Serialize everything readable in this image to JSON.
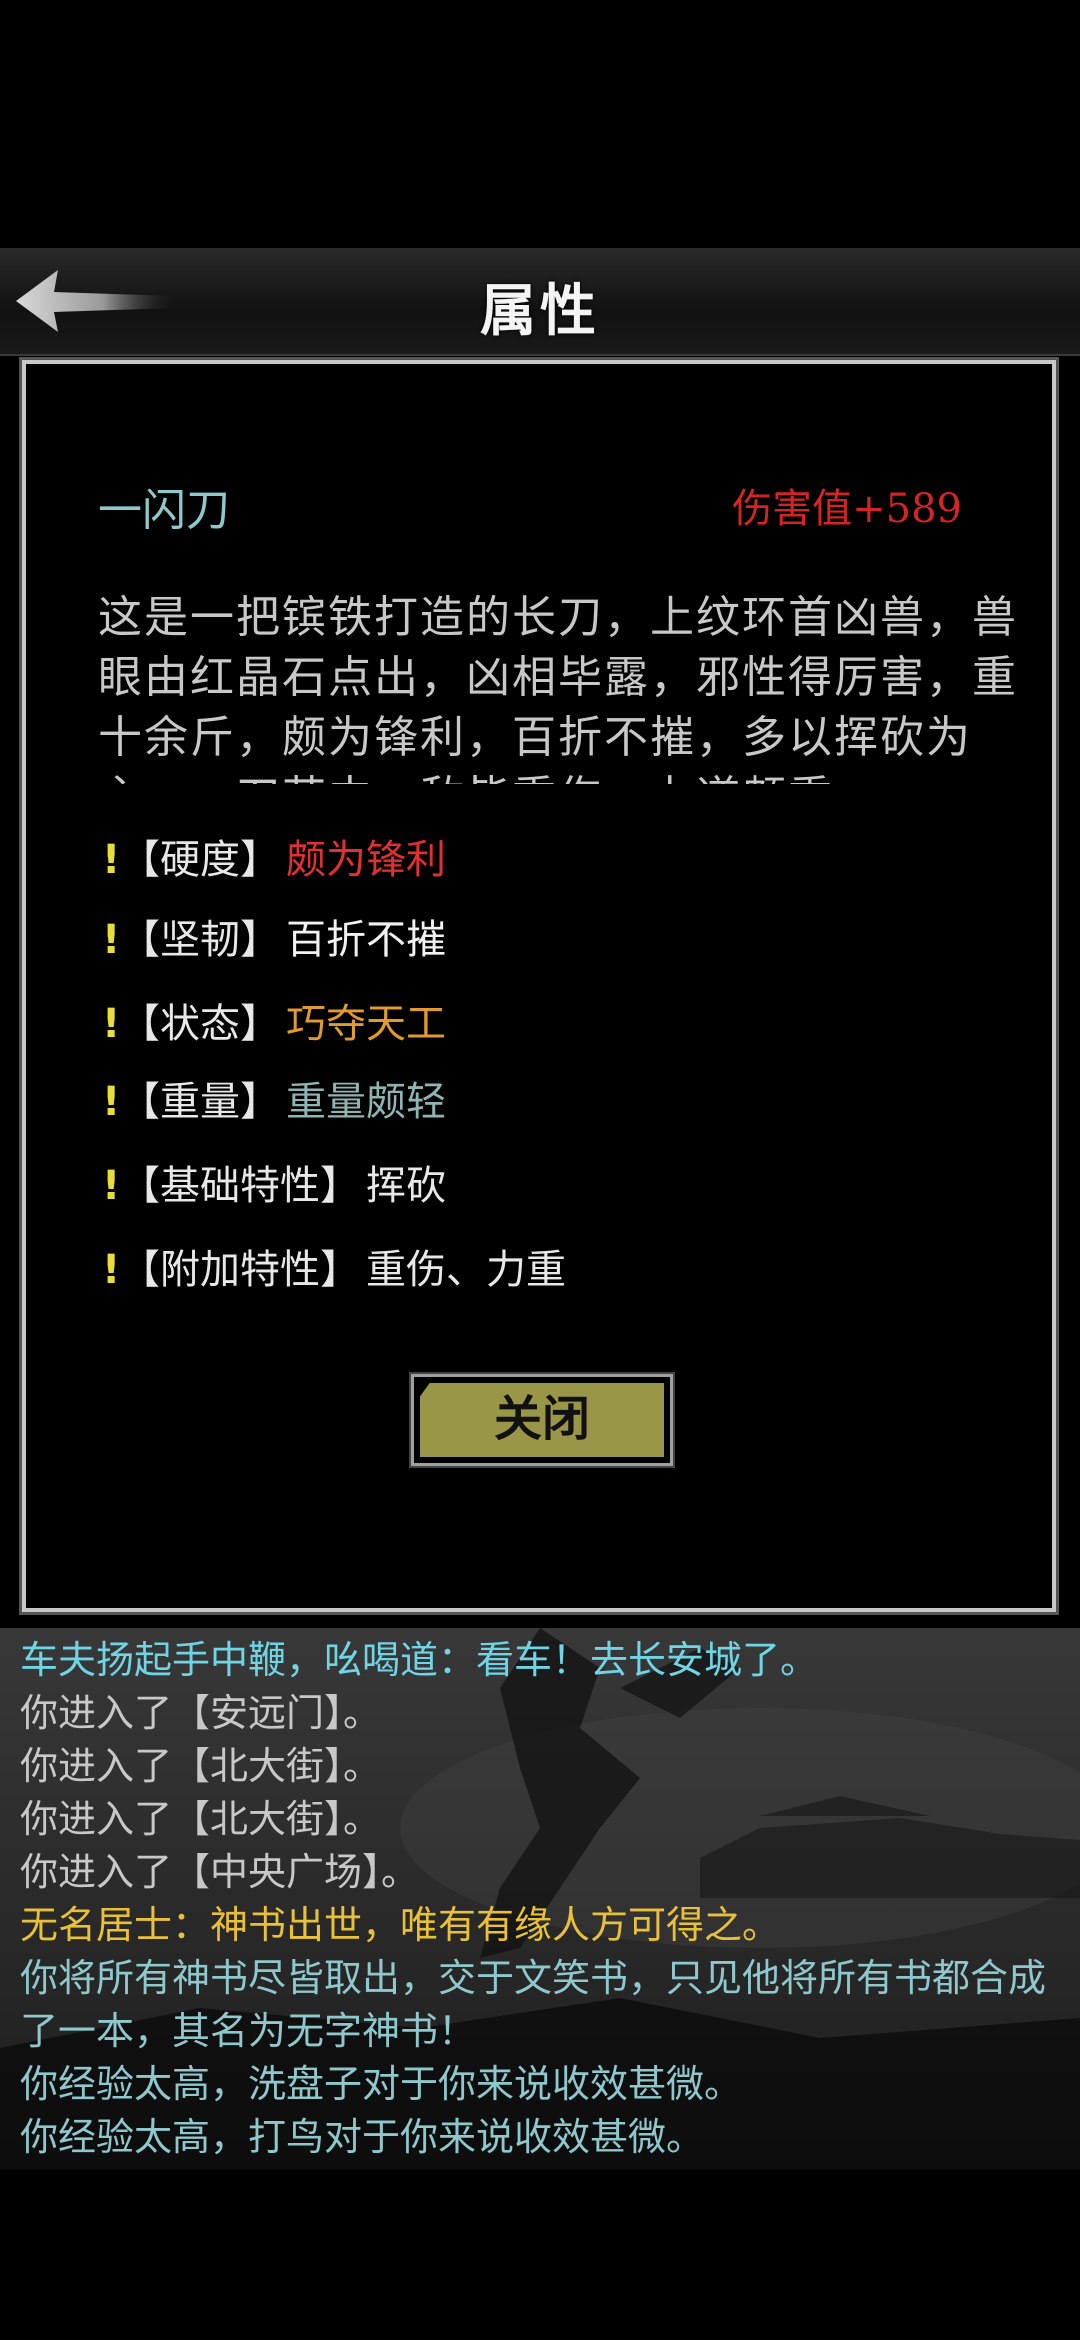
{
  "header": {
    "title": "属性"
  },
  "item": {
    "name": "一闪刀",
    "damage": "伤害值+589",
    "description": "这是一把镔铁打造的长刀，上纹环首凶兽，兽眼由红晶石点出，凶相毕露，邪性得厉害，重十余斤，颇为锋利，百折不摧，多以挥砍为主，一刀若中，敌皆重伤，力道颇重"
  },
  "attributes": [
    {
      "mark": "!",
      "label": "【硬度】",
      "value": "颇为锋利",
      "color": "#e23030"
    },
    {
      "mark": "!",
      "label": "【坚韧】",
      "value": "百折不摧",
      "color": "#f2f2f2"
    },
    {
      "mark": "!",
      "label": "【状态】",
      "value": "巧夺天工",
      "color": "#e09a30"
    },
    {
      "mark": "!",
      "label": "【重量】",
      "value": "重量颇轻",
      "color": "#8fb4b4"
    },
    {
      "mark": "!",
      "label": "【基础特性】",
      "value": "挥砍",
      "color": "#e8e8e8"
    },
    {
      "mark": "!",
      "label": "【附加特性】",
      "value": "重伤、力重",
      "color": "#e8e8e8"
    }
  ],
  "buttons": {
    "close": "关闭"
  },
  "log": [
    {
      "text": "车夫扬起手中鞭，吆喝道：看车！去长安城了。",
      "color": "#6fd4e4"
    },
    {
      "text": "你进入了【安远门】。",
      "color": "#c8c8c8"
    },
    {
      "text": "你进入了【北大街】。",
      "color": "#c8c8c8"
    },
    {
      "text": "你进入了【北大街】。",
      "color": "#c8c8c8"
    },
    {
      "text": "你进入了【中央广场】。",
      "color": "#c8c8c8"
    },
    {
      "text": "无名居士：神书出世，唯有有缘人方可得之。",
      "color": "#e8c03a"
    },
    {
      "text": "你将所有神书尽皆取出，交于文笑书，只见他将所有书都合成了一本，其名为无字神书！",
      "color": "#8ec8cc"
    },
    {
      "text": "你经验太高，洗盘子对于你来说收效甚微。",
      "color": "#8ec8cc"
    },
    {
      "text": "你经验太高，打鸟对于你来说收效甚微。",
      "color": "#8ec8cc"
    }
  ],
  "icons": {
    "back": "back-arrow-icon",
    "attribute_mark": "exclamation-icon"
  }
}
